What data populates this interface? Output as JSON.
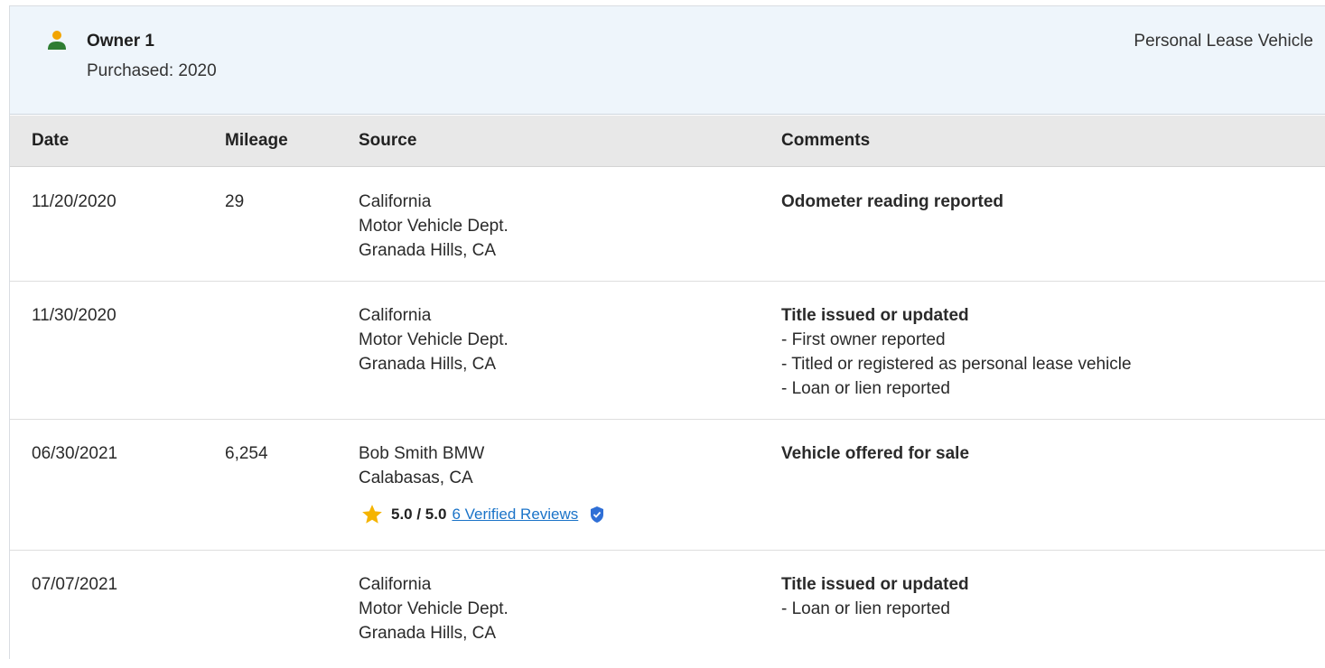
{
  "owner": {
    "name": "Owner 1",
    "purchased": "Purchased: 2020",
    "vehicle_type": "Personal Lease Vehicle",
    "icon": "person-icon",
    "icon_colors": {
      "head": "#f2a400",
      "body": "#2e7d32"
    }
  },
  "columns": {
    "date": "Date",
    "mileage": "Mileage",
    "source": "Source",
    "comments": "Comments"
  },
  "rows": [
    {
      "date": "11/20/2020",
      "mileage": "29",
      "source": [
        "California",
        "Motor Vehicle Dept.",
        "Granada Hills, CA"
      ],
      "comment_title": "Odometer reading reported",
      "comment_items": []
    },
    {
      "date": "11/30/2020",
      "mileage": "",
      "source": [
        "California",
        "Motor Vehicle Dept.",
        "Granada Hills, CA"
      ],
      "comment_title": "Title issued or updated",
      "comment_items": [
        "- First owner reported",
        "- Titled or registered as personal lease vehicle",
        "- Loan or lien reported"
      ]
    },
    {
      "date": "06/30/2021",
      "mileage": "6,254",
      "source": [
        "Bob Smith BMW",
        "Calabasas, CA"
      ],
      "rating": {
        "score": "5.0 / 5.0",
        "reviews": "6 Verified Reviews",
        "stars": 5.0
      },
      "comment_title": "Vehicle offered for sale",
      "comment_items": []
    },
    {
      "date": "07/07/2021",
      "mileage": "",
      "source": [
        "California",
        "Motor Vehicle Dept.",
        "Granada Hills, CA"
      ],
      "comment_title": "Title issued or updated",
      "comment_items": [
        "- Loan or lien reported"
      ]
    }
  ],
  "colors": {
    "header_bg": "#eef5fb",
    "column_header_bg": "#e8e8e8",
    "link": "#1a73c8",
    "star": "#f5b400",
    "verified": "#2f6fd6"
  }
}
